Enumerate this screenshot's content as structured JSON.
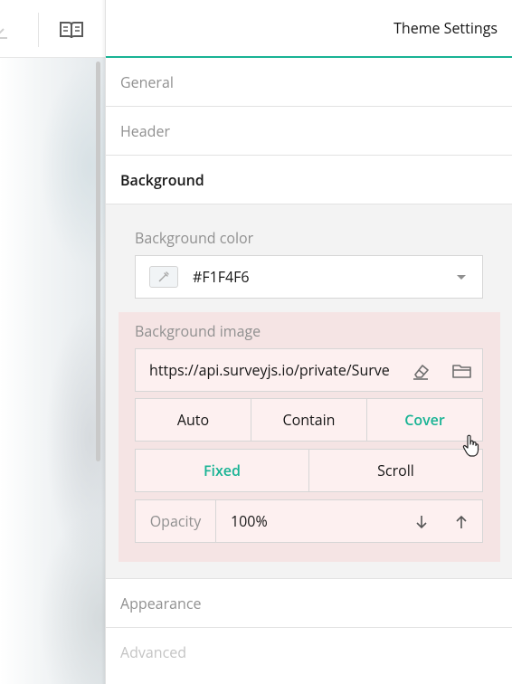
{
  "toolbar": {
    "download_icon": "download-icon",
    "book_icon": "book-open-icon"
  },
  "panel": {
    "title": "Theme Settings",
    "sections": {
      "general": "General",
      "header": "Header",
      "background": "Background",
      "appearance": "Appearance",
      "advanced": "Advanced"
    }
  },
  "background": {
    "color_label": "Background color",
    "color_value": "#F1F4F6",
    "image_label": "Background image",
    "image_url": "https://api.surveyjs.io/private/Surve",
    "fit_options": [
      "Auto",
      "Contain",
      "Cover"
    ],
    "fit_selected": "Cover",
    "attachment_options": [
      "Fixed",
      "Scroll"
    ],
    "attachment_selected": "Fixed",
    "opacity_label": "Opacity",
    "opacity_value": "100%"
  },
  "colors": {
    "accent": "#19b394",
    "highlight_box": "#f5e4e4",
    "panel_bg": "#f3f3f3"
  }
}
